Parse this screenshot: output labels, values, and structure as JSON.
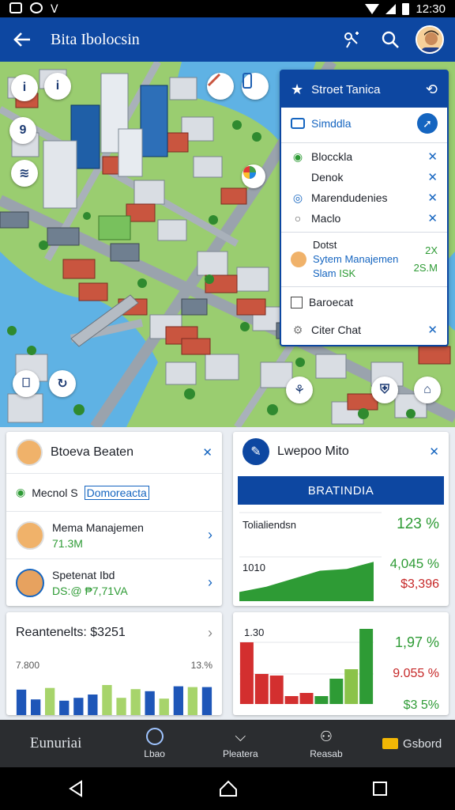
{
  "status_bar": {
    "time": "12:30"
  },
  "app_bar": {
    "title": "Bita Ibolocsin"
  },
  "colors": {
    "primary": "#0d47a1",
    "accent": "#1565c0",
    "positive": "#2e9b35",
    "negative": "#c62828"
  },
  "map": {
    "pins_left": [
      "i",
      "i",
      "9",
      "≋"
    ],
    "pins_bottom": [
      "⎕",
      "↻",
      "⚘",
      "⛨",
      "⌂"
    ]
  },
  "layer_panel": {
    "header": "Stroet Tanica",
    "selected": "Simddla",
    "items": [
      {
        "label": "Blocckla",
        "icon": "leaf-icon"
      },
      {
        "label": "Denok",
        "icon": "blank-icon"
      },
      {
        "label": "Marendudenies",
        "icon": "globe-icon"
      },
      {
        "label": "Maclo",
        "icon": "circle-icon"
      }
    ],
    "detail": {
      "line1": "Dotst",
      "line2": "Sytem Manajemen",
      "line3": "Slam",
      "tag": "ISK",
      "val1": "2X",
      "val2": "2S.M"
    },
    "footer_items": [
      {
        "label": "Baroecat"
      },
      {
        "label": "Citer Chat"
      }
    ]
  },
  "card_people": {
    "title": "Btoeva Beaten",
    "subrow": {
      "prefix": "Mecnol S",
      "link": "Domoreacta"
    },
    "people": [
      {
        "name": "Mema Manajemen",
        "value": "71.3M"
      },
      {
        "name": "Spetenat Ibd",
        "value": "DS:@ ₱7,71VA"
      }
    ]
  },
  "card_metrics": {
    "title": "Lwepoo Mito",
    "button": "BRATINDIA",
    "label_top": "Tolialiendsn",
    "label_mid": "1010",
    "metric1": "123 %",
    "metric2": "4,045 %",
    "metric3": "$3,396"
  },
  "card_bars": {
    "title": "Reantenelts: $3251",
    "label_left": "7.800",
    "label_right": "13.%"
  },
  "card_bars2": {
    "label_top": "1.30",
    "metric1": "1,97 %",
    "metric2": "9.055 %",
    "metric3": "$3 5%"
  },
  "bottom_nav": {
    "brand": "Eunuriai",
    "items": [
      "Lbao",
      "Pleatera",
      "Reasab"
    ],
    "last": "Gsbord"
  },
  "chart_data": [
    {
      "type": "area",
      "title": "",
      "series": [
        {
          "values": [
            10,
            22,
            40,
            58,
            62,
            78
          ]
        }
      ],
      "ylim": [
        0,
        100
      ]
    },
    {
      "type": "bar",
      "title": "Reantenelts: $3251",
      "series": [
        {
          "color": "#1e56b8",
          "values": [
            62,
            38,
            66,
            35,
            42,
            50,
            73,
            42,
            63,
            58,
            40,
            70,
            68,
            68
          ]
        },
        {
          "color": "#9ccc65",
          "values": []
        }
      ],
      "bar_colors": [
        "#1e56b8",
        "#1e56b8",
        "#a7d46b",
        "#1e56b8",
        "#1e56b8",
        "#1e56b8",
        "#a7d46b",
        "#a7d46b",
        "#a7d46b",
        "#1e56b8",
        "#a7d46b",
        "#1e56b8",
        "#a7d46b",
        "#1e56b8"
      ]
    },
    {
      "type": "bar",
      "title": "",
      "values": [
        78,
        38,
        36,
        10,
        14,
        10,
        32,
        44,
        95
      ],
      "bar_colors": [
        "#d32f2f",
        "#d32f2f",
        "#d32f2f",
        "#d32f2f",
        "#d32f2f",
        "#2e9b35",
        "#2e9b35",
        "#8bc34a",
        "#2e9b35"
      ]
    }
  ]
}
